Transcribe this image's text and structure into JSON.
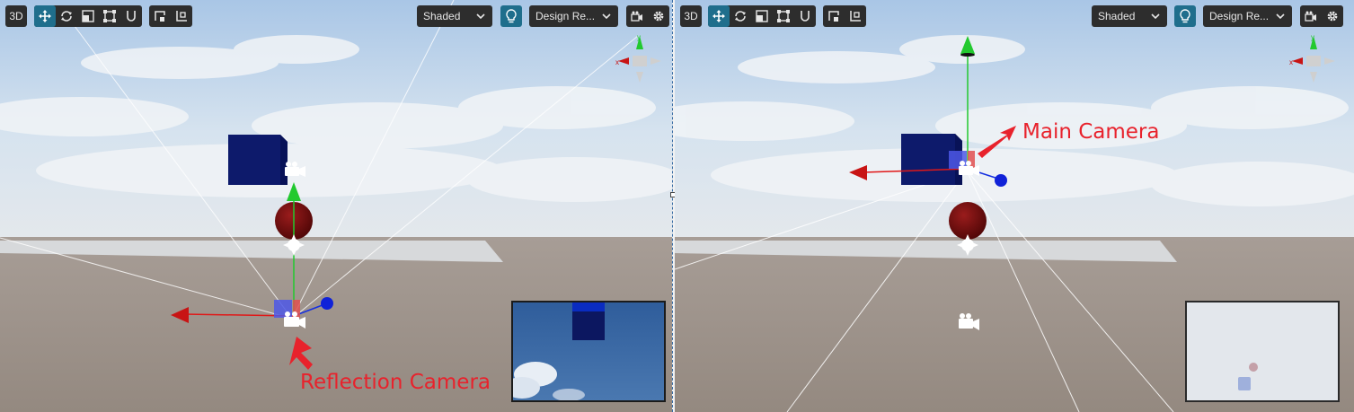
{
  "left_view": {
    "mode_3d": "3D",
    "shading": "Shaded",
    "render_pipeline": "Design Re...",
    "annotation": "Reflection Camera"
  },
  "right_view": {
    "mode_3d": "3D",
    "shading": "Shaded",
    "render_pipeline": "Design Re...",
    "annotation": "Main Camera"
  },
  "gizmo_axis": {
    "x_label": "x",
    "y_label": "y"
  },
  "colors": {
    "toolbar_bg": "#2d2d2d",
    "active_tool": "#1f6e8c",
    "annotation": "#e8222c",
    "cube": "#0d1a6b",
    "sphere": "#7a0e0e"
  },
  "icons": [
    "move-icon",
    "rotate-icon",
    "scale-icon",
    "rect-icon",
    "snap-icon",
    "local-icon",
    "pivot-icon",
    "light-icon",
    "camera-icon",
    "gear-icon"
  ]
}
